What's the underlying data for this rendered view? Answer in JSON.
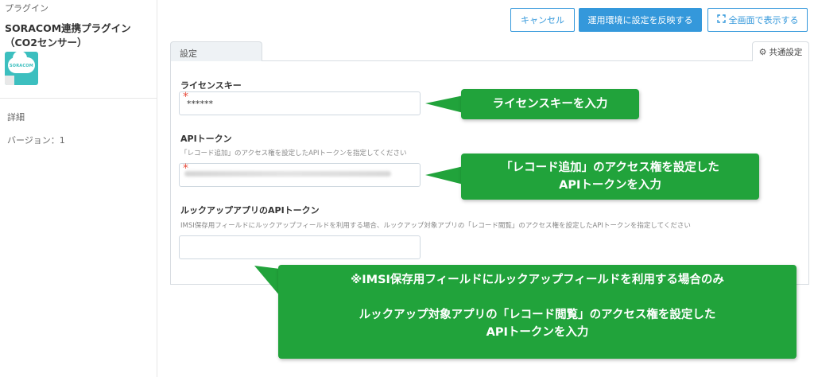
{
  "sidebar": {
    "breadcrumb": "プラグイン",
    "plugin_name_line1": "SORACOM連携プラグイン",
    "plugin_name_line2": "（CO2センサー）",
    "logo_text": "SORACOM",
    "details_label": "詳細",
    "version_label": "バージョン：1"
  },
  "header": {
    "cancel_label": "キャンセル",
    "apply_label": "運用環境に設定を反映する",
    "fullscreen_label": "全画面で表示する",
    "fullscreen_icon": "expand-icon"
  },
  "tabs": {
    "settings_label": "設定",
    "common_settings_label": "共通設定",
    "common_settings_icon": "gear-icon"
  },
  "form": {
    "license": {
      "label": "ライセンスキー",
      "value": "******",
      "required": true
    },
    "api_token": {
      "label": "APIトークン",
      "description": "「レコード追加」のアクセス権を設定したAPIトークンを指定してください",
      "required": true
    },
    "lookup_token": {
      "label": "ルックアップアプリのAPIトークン",
      "description": "IMSI保存用フィールドにルックアップフィールドを利用する場合、ルックアップ対象アプリの「レコード閲覧」のアクセス権を設定したAPIトークンを指定してください",
      "value": ""
    }
  },
  "callouts": {
    "license": "ライセンスキーを入力",
    "api_line1": "「レコード追加」のアクセス権を設定した",
    "api_line2": "APIトークンを入力",
    "lookup_line1": "※IMSI保存用フィールドにルックアップフィールドを利用する場合のみ",
    "lookup_line2": "ルックアップ対象アプリの「レコード閲覧」のアクセス権を設定した",
    "lookup_line3": "APIトークンを入力"
  },
  "colors": {
    "accent": "#3498db",
    "callout_green": "#21a33b",
    "required_red": "#e74c3c"
  }
}
